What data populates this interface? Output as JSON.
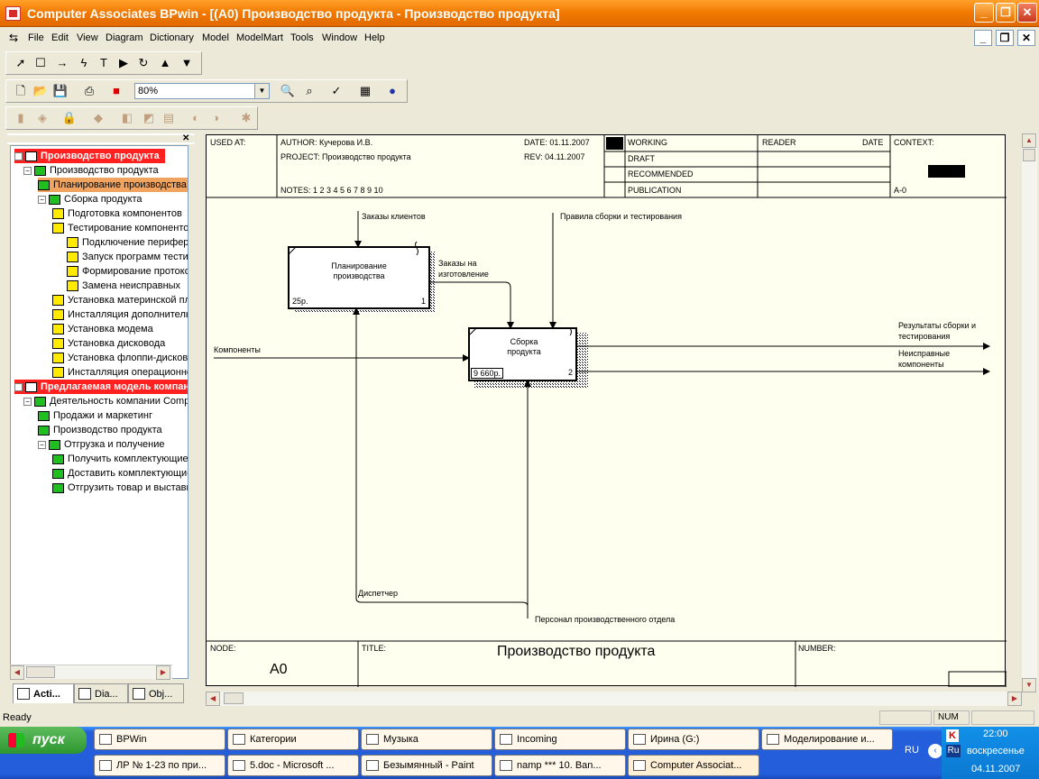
{
  "window": {
    "title": "Computer Associates BPwin - [(A0) Производство продукта - Производство продукта]",
    "min_icon": "minimize-icon",
    "max_icon": "maximize-icon",
    "close_icon": "close-icon"
  },
  "menu": [
    "File",
    "Edit",
    "View",
    "Diagram",
    "Dictionary",
    "Model",
    "ModelMart",
    "Tools",
    "Window",
    "Help"
  ],
  "toolbar": {
    "zoom_value": "80%"
  },
  "tree": [
    {
      "label": "Производство продукта",
      "kind": "model"
    },
    {
      "label": "Производство продукта",
      "kind": "box"
    },
    {
      "label": "Планирование производства",
      "kind": "box",
      "selected": true
    },
    {
      "label": "Сборка продукта",
      "kind": "box"
    },
    {
      "label": "Подготовка компонентов",
      "kind": "doc"
    },
    {
      "label": "Тестирование компонентов",
      "kind": "doc"
    },
    {
      "label": "Подключение периферии",
      "kind": "doc"
    },
    {
      "label": "Запуск программ тестирования",
      "kind": "doc"
    },
    {
      "label": "Формирование протокола",
      "kind": "doc"
    },
    {
      "label": "Замена неисправных",
      "kind": "doc"
    },
    {
      "label": "Установка материнской платы",
      "kind": "doc"
    },
    {
      "label": "Инсталляция дополнительных",
      "kind": "doc"
    },
    {
      "label": "Установка модема",
      "kind": "doc"
    },
    {
      "label": "Установка дисковода",
      "kind": "doc"
    },
    {
      "label": "Установка флоппи-дисковода",
      "kind": "doc"
    },
    {
      "label": "Инсталляция операционной",
      "kind": "doc"
    },
    {
      "label": "Предлагаемая модель компании",
      "kind": "model"
    },
    {
      "label": "Деятельность компании Computer",
      "kind": "box"
    },
    {
      "label": "Продажи и маркетинг",
      "kind": "box"
    },
    {
      "label": "Производство продукта",
      "kind": "box"
    },
    {
      "label": "Отгрузка и получение",
      "kind": "box"
    },
    {
      "label": "Получить комплектующие",
      "kind": "box"
    },
    {
      "label": "Доставить комплектующие",
      "kind": "box"
    },
    {
      "label": "Отгрузить товар и выставить",
      "kind": "box"
    }
  ],
  "tabs": [
    "Acti...",
    "Dia...",
    "Obj..."
  ],
  "diagram": {
    "used_at": "USED AT:",
    "author": "AUTHOR:  Кучерова И.В.",
    "project": "PROJECT:  Производство продукта",
    "date": "DATE: 01.11.2007",
    "rev": "REV:  04.11.2007",
    "notes": "NOTES:  1  2  3  4  5  6  7  8  9  10",
    "status": [
      "WORKING",
      "DRAFT",
      "RECOMMENDED",
      "PUBLICATION"
    ],
    "reader": "READER",
    "date2": "DATE",
    "context": "CONTEXT:",
    "context_node": "A-0",
    "node_label": "NODE:",
    "node_value": "A0",
    "title_label": "TITLE:",
    "title_value": "Производство продукта",
    "number_label": "NUMBER:",
    "box1": {
      "name": "Планирование производства",
      "cost": "25р.",
      "num": "1"
    },
    "box2": {
      "name": "Сборка продукта",
      "cost": "9 660р.",
      "num": "2"
    },
    "arrows": {
      "orders": "Заказы клиентов",
      "rules": "Правила сборки и тестирования",
      "prod_orders": "Заказы на изготовление",
      "components": "Компоненты",
      "results": "Результаты сборки и тестирования",
      "bad": "Неисправные компоненты",
      "dispatcher": "Диспетчер",
      "staff": "Персонал производственного отдела"
    }
  },
  "status": {
    "text": "Ready",
    "num": "NUM"
  },
  "taskbar": {
    "start": "пуск",
    "row1": [
      "BPWin",
      "Категории",
      "Музыка",
      "Incoming",
      "Ирина (G:)",
      "Моделирование и..."
    ],
    "row2": [
      "ЛР № 1-23 по при...",
      "5.doc - Microsoft ...",
      "Безымянный - Paint",
      "namp *** 10. Ban...",
      "Computer Associat..."
    ]
  },
  "tray": {
    "lang": "RU",
    "time": "22:00",
    "day": "воскресенье",
    "date": "04.11.2007",
    "ru": "Ru"
  }
}
